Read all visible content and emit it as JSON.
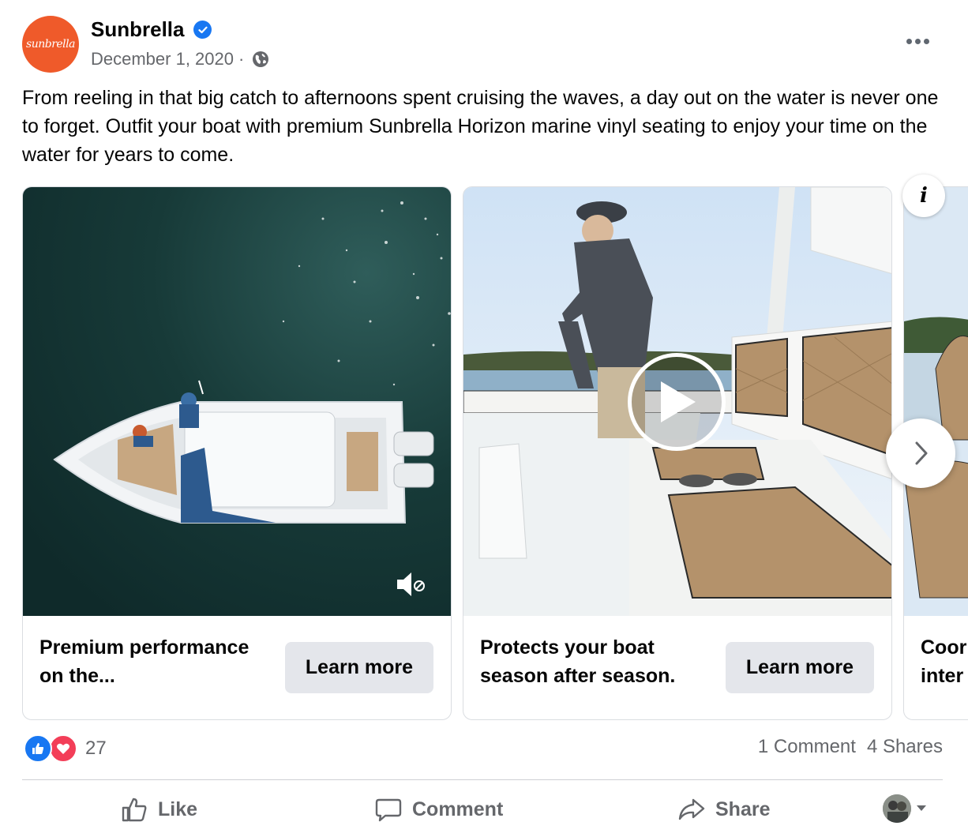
{
  "post": {
    "page_name": "Sunbrella",
    "avatar_text": "sunbrella",
    "date": "December 1, 2020",
    "meta_separator": "·",
    "caption": "From reeling in that big catch to afternoons spent cruising the waves, a day out on the water is never one to forget. Outfit your boat with premium Sunbrella Horizon marine vinyl seating to enjoy your time on the water for years to come."
  },
  "carousel": {
    "cards": [
      {
        "title": "Premium performance on the...",
        "button": "Learn more"
      },
      {
        "title": "Protects your boat season after season.",
        "button": "Learn more"
      },
      {
        "title": "Coor inter",
        "button": ""
      }
    ]
  },
  "reactions": {
    "count": "27",
    "comments": "1 Comment",
    "shares": "4 Shares"
  },
  "actions": {
    "like": "Like",
    "comment": "Comment",
    "share": "Share"
  },
  "colors": {
    "brand": "#ef5a2a",
    "facebook_blue": "#1877f2",
    "love": "#f33e58",
    "secondary_text": "#65676b"
  }
}
